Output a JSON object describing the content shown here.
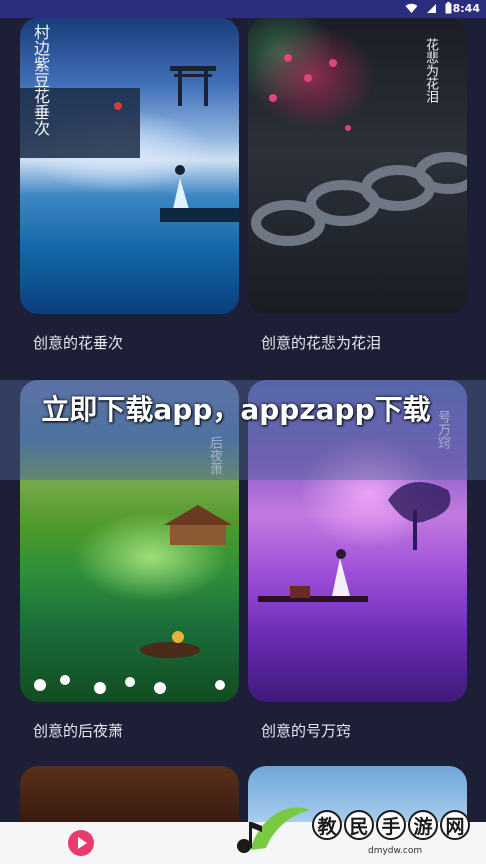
{
  "status_bar": {
    "time": "8:44"
  },
  "cards": [
    {
      "caption": "创意的花垂次",
      "art_text": "村边紫豆花垂次"
    },
    {
      "caption": "创意的花悲为花泪",
      "art_text": "花悲为花泪"
    },
    {
      "caption": "创意的后夜萧",
      "art_text": "后夜萧"
    },
    {
      "caption": "创意的号万窍",
      "art_text": "号万窍"
    }
  ],
  "banner": {
    "text": "立即下载app，appzapp下载"
  },
  "watermark": {
    "chars": [
      "教",
      "民",
      "手",
      "游",
      "网"
    ],
    "url": "dmydw.com"
  },
  "colors": {
    "background": "#1c1f35",
    "status_bar": "#2b2d7d",
    "play_button": "#e93b6d",
    "watermark_green": "#7ac943"
  },
  "icons": [
    "wifi-icon",
    "signal-icon",
    "battery-icon",
    "play-icon",
    "music-note-icon"
  ]
}
